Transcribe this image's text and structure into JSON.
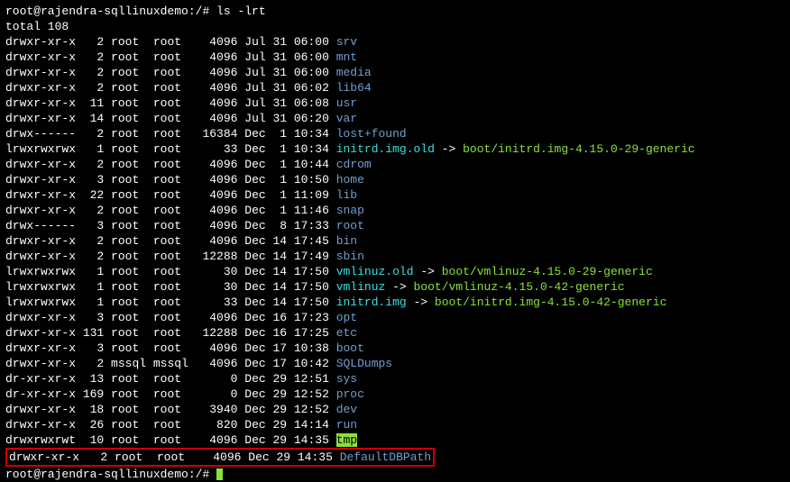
{
  "prompt1": {
    "user": "root@rajendra-sqllinuxdemo",
    "path": ":/#",
    "cmd": " ls -lrt"
  },
  "total": "total 108",
  "rows": [
    {
      "perm": "drwxr-xr-x",
      "n": "   2",
      "u": " root ",
      "g": " root  ",
      "s": "  4096",
      "d": " Jul 31 06:00 ",
      "name": "srv",
      "cls": "dir"
    },
    {
      "perm": "drwxr-xr-x",
      "n": "   2",
      "u": " root ",
      "g": " root  ",
      "s": "  4096",
      "d": " Jul 31 06:00 ",
      "name": "mnt",
      "cls": "dir"
    },
    {
      "perm": "drwxr-xr-x",
      "n": "   2",
      "u": " root ",
      "g": " root  ",
      "s": "  4096",
      "d": " Jul 31 06:00 ",
      "name": "media",
      "cls": "dir"
    },
    {
      "perm": "drwxr-xr-x",
      "n": "   2",
      "u": " root ",
      "g": " root  ",
      "s": "  4096",
      "d": " Jul 31 06:02 ",
      "name": "lib64",
      "cls": "dir"
    },
    {
      "perm": "drwxr-xr-x",
      "n": "  11",
      "u": " root ",
      "g": " root  ",
      "s": "  4096",
      "d": " Jul 31 06:08 ",
      "name": "usr",
      "cls": "dir"
    },
    {
      "perm": "drwxr-xr-x",
      "n": "  14",
      "u": " root ",
      "g": " root  ",
      "s": "  4096",
      "d": " Jul 31 06:20 ",
      "name": "var",
      "cls": "dir"
    },
    {
      "perm": "drwx------",
      "n": "   2",
      "u": " root ",
      "g": " root  ",
      "s": " 16384",
      "d": " Dec  1 10:34 ",
      "name": "lost+found",
      "cls": "dir"
    },
    {
      "perm": "lrwxrwxrwx",
      "n": "   1",
      "u": " root ",
      "g": " root  ",
      "s": "    33",
      "d": " Dec  1 10:34 ",
      "name": "initrd.img.old",
      "cls": "link",
      "arrow": " -> ",
      "target": "boot/initrd.img-4.15.0-29-generic"
    },
    {
      "perm": "drwxr-xr-x",
      "n": "   2",
      "u": " root ",
      "g": " root  ",
      "s": "  4096",
      "d": " Dec  1 10:44 ",
      "name": "cdrom",
      "cls": "dir"
    },
    {
      "perm": "drwxr-xr-x",
      "n": "   3",
      "u": " root ",
      "g": " root  ",
      "s": "  4096",
      "d": " Dec  1 10:50 ",
      "name": "home",
      "cls": "dir"
    },
    {
      "perm": "drwxr-xr-x",
      "n": "  22",
      "u": " root ",
      "g": " root  ",
      "s": "  4096",
      "d": " Dec  1 11:09 ",
      "name": "lib",
      "cls": "dir"
    },
    {
      "perm": "drwxr-xr-x",
      "n": "   2",
      "u": " root ",
      "g": " root  ",
      "s": "  4096",
      "d": " Dec  1 11:46 ",
      "name": "snap",
      "cls": "dir"
    },
    {
      "perm": "drwx------",
      "n": "   3",
      "u": " root ",
      "g": " root  ",
      "s": "  4096",
      "d": " Dec  8 17:33 ",
      "name": "root",
      "cls": "dir"
    },
    {
      "perm": "drwxr-xr-x",
      "n": "   2",
      "u": " root ",
      "g": " root  ",
      "s": "  4096",
      "d": " Dec 14 17:45 ",
      "name": "bin",
      "cls": "dir"
    },
    {
      "perm": "drwxr-xr-x",
      "n": "   2",
      "u": " root ",
      "g": " root  ",
      "s": " 12288",
      "d": " Dec 14 17:49 ",
      "name": "sbin",
      "cls": "dir"
    },
    {
      "perm": "lrwxrwxrwx",
      "n": "   1",
      "u": " root ",
      "g": " root  ",
      "s": "    30",
      "d": " Dec 14 17:50 ",
      "name": "vmlinuz.old",
      "cls": "link",
      "arrow": " -> ",
      "target": "boot/vmlinuz-4.15.0-29-generic"
    },
    {
      "perm": "lrwxrwxrwx",
      "n": "   1",
      "u": " root ",
      "g": " root  ",
      "s": "    30",
      "d": " Dec 14 17:50 ",
      "name": "vmlinuz",
      "cls": "link",
      "arrow": " -> ",
      "target": "boot/vmlinuz-4.15.0-42-generic"
    },
    {
      "perm": "lrwxrwxrwx",
      "n": "   1",
      "u": " root ",
      "g": " root  ",
      "s": "    33",
      "d": " Dec 14 17:50 ",
      "name": "initrd.img",
      "cls": "link",
      "arrow": " -> ",
      "target": "boot/initrd.img-4.15.0-42-generic"
    },
    {
      "perm": "drwxr-xr-x",
      "n": "   3",
      "u": " root ",
      "g": " root  ",
      "s": "  4096",
      "d": " Dec 16 17:23 ",
      "name": "opt",
      "cls": "dir"
    },
    {
      "perm": "drwxr-xr-x",
      "n": " 131",
      "u": " root ",
      "g": " root  ",
      "s": " 12288",
      "d": " Dec 16 17:25 ",
      "name": "etc",
      "cls": "dir"
    },
    {
      "perm": "drwxr-xr-x",
      "n": "   3",
      "u": " root ",
      "g": " root  ",
      "s": "  4096",
      "d": " Dec 17 10:38 ",
      "name": "boot",
      "cls": "dir"
    },
    {
      "perm": "drwxr-xr-x",
      "n": "   2",
      "u": " mssql",
      "g": " mssql ",
      "s": "  4096",
      "d": " Dec 17 10:42 ",
      "name": "SQLDumps",
      "cls": "dir"
    },
    {
      "perm": "dr-xr-xr-x",
      "n": "  13",
      "u": " root ",
      "g": " root  ",
      "s": "     0",
      "d": " Dec 29 12:51 ",
      "name": "sys",
      "cls": "dir"
    },
    {
      "perm": "dr-xr-xr-x",
      "n": " 169",
      "u": " root ",
      "g": " root  ",
      "s": "     0",
      "d": " Dec 29 12:52 ",
      "name": "proc",
      "cls": "dir"
    },
    {
      "perm": "drwxr-xr-x",
      "n": "  18",
      "u": " root ",
      "g": " root  ",
      "s": "  3940",
      "d": " Dec 29 12:52 ",
      "name": "dev",
      "cls": "dir"
    },
    {
      "perm": "drwxr-xr-x",
      "n": "  26",
      "u": " root ",
      "g": " root  ",
      "s": "   820",
      "d": " Dec 29 14:14 ",
      "name": "run",
      "cls": "dir"
    },
    {
      "perm": "drwxrwxrwt",
      "n": "  10",
      "u": " root ",
      "g": " root  ",
      "s": "  4096",
      "d": " Dec 29 14:35 ",
      "name": "tmp",
      "cls": "sticky"
    }
  ],
  "highlight": {
    "perm": "drwxr-xr-x",
    "n": "   2",
    "u": " root ",
    "g": " root  ",
    "s": "  4096",
    "d": " Dec 29 14:35 ",
    "name": "DefaultDBPath",
    "cls": "dir"
  },
  "prompt2": {
    "user": "root@rajendra-sqllinuxdemo",
    "path": ":/#",
    "cmd": " "
  }
}
